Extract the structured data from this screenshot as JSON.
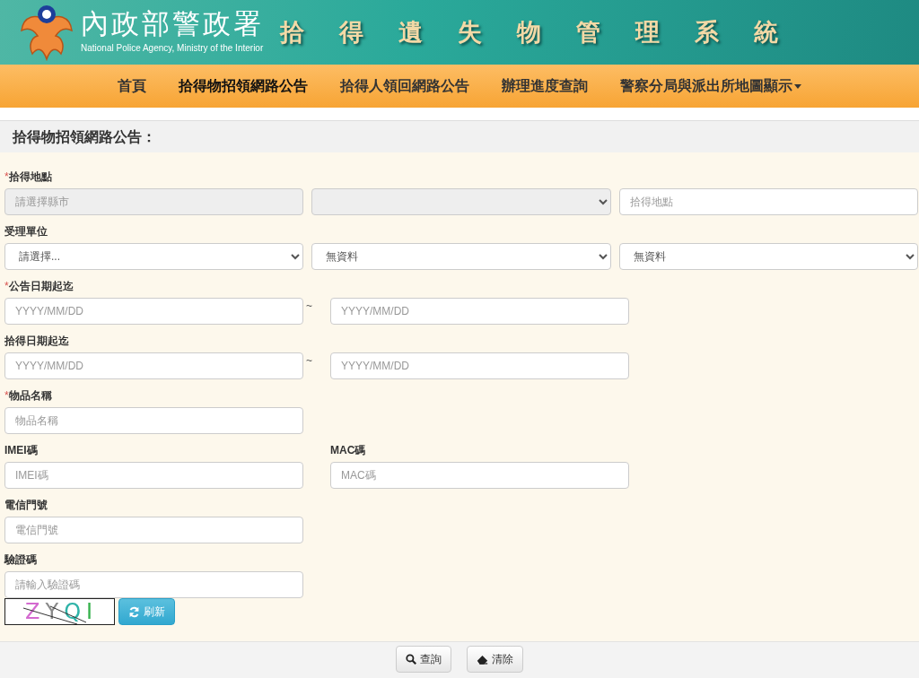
{
  "header": {
    "agency_name": "內政部警政署",
    "agency_name_en": "National Police Agency, Ministry of the Interior",
    "system_title": "拾得遺失物管理系統"
  },
  "nav": [
    {
      "label": "首頁",
      "selected": false,
      "dropdown": false
    },
    {
      "label": "拾得物招領網路公告",
      "selected": true,
      "dropdown": false
    },
    {
      "label": "拾得人領回網路公告",
      "selected": false,
      "dropdown": false
    },
    {
      "label": "辦理進度查詢",
      "selected": false,
      "dropdown": false
    },
    {
      "label": "警察分局與派出所地圖顯示",
      "selected": false,
      "dropdown": true
    }
  ],
  "section_title": "拾得物招領網路公告：",
  "required_mark": "*",
  "rows": [
    {
      "kind": "triple",
      "cells": [
        {
          "label": "拾得地點",
          "required": true,
          "control": {
            "kind": "input",
            "placeholder": "請選擇縣市",
            "disabled": true
          }
        },
        {
          "control": {
            "kind": "select",
            "disabled": true
          }
        },
        {
          "control": {
            "kind": "input",
            "placeholder": "拾得地點",
            "disabled": false
          }
        }
      ]
    },
    {
      "kind": "triple",
      "cells": [
        {
          "label": "受理單位",
          "required": false,
          "control": {
            "kind": "select",
            "value": "請選擇...",
            "disabled": false
          }
        },
        {
          "control": {
            "kind": "select",
            "value": "無資料",
            "disabled": false
          }
        },
        {
          "control": {
            "kind": "select",
            "value": "無資料",
            "disabled": false
          }
        }
      ]
    },
    {
      "kind": "range",
      "separator": "~",
      "cells": [
        {
          "label": "公告日期起迄",
          "required": true,
          "control": {
            "kind": "input",
            "placeholder": "YYYY/MM/DD",
            "disabled": false
          }
        },
        {
          "control": {
            "kind": "input",
            "placeholder": "YYYY/MM/DD",
            "disabled": false
          }
        }
      ]
    },
    {
      "kind": "range",
      "separator": "~",
      "cells": [
        {
          "label": "拾得日期起迄",
          "required": false,
          "control": {
            "kind": "input",
            "placeholder": "YYYY/MM/DD",
            "disabled": false
          }
        },
        {
          "control": {
            "kind": "input",
            "placeholder": "YYYY/MM/DD",
            "disabled": false
          }
        }
      ]
    },
    {
      "kind": "pair",
      "cells": [
        {
          "label": "物品名稱",
          "required": true,
          "control": {
            "kind": "input",
            "placeholder": "物品名稱",
            "disabled": false
          }
        }
      ]
    },
    {
      "kind": "pair",
      "cells": [
        {
          "label": "IMEI碼",
          "required": false,
          "control": {
            "kind": "input",
            "placeholder": "IMEI碼",
            "disabled": false
          }
        },
        {
          "label": "MAC碼",
          "required": false,
          "control": {
            "kind": "input",
            "placeholder": "MAC碼",
            "disabled": false
          }
        }
      ]
    },
    {
      "kind": "pair",
      "cells": [
        {
          "label": "電信門號",
          "required": false,
          "control": {
            "kind": "input",
            "placeholder": "電信門號",
            "disabled": false
          }
        }
      ]
    },
    {
      "kind": "pair",
      "cells": [
        {
          "label": "驗證碼",
          "required": false,
          "control": {
            "kind": "input",
            "placeholder": "請輸入驗證碼",
            "disabled": false
          }
        }
      ]
    }
  ],
  "captcha": {
    "text": "ZYQI",
    "refresh_label": "刷新"
  },
  "footer_buttons": [
    {
      "kind": "search",
      "label": "查詢"
    },
    {
      "kind": "eraser",
      "label": "清除"
    }
  ]
}
